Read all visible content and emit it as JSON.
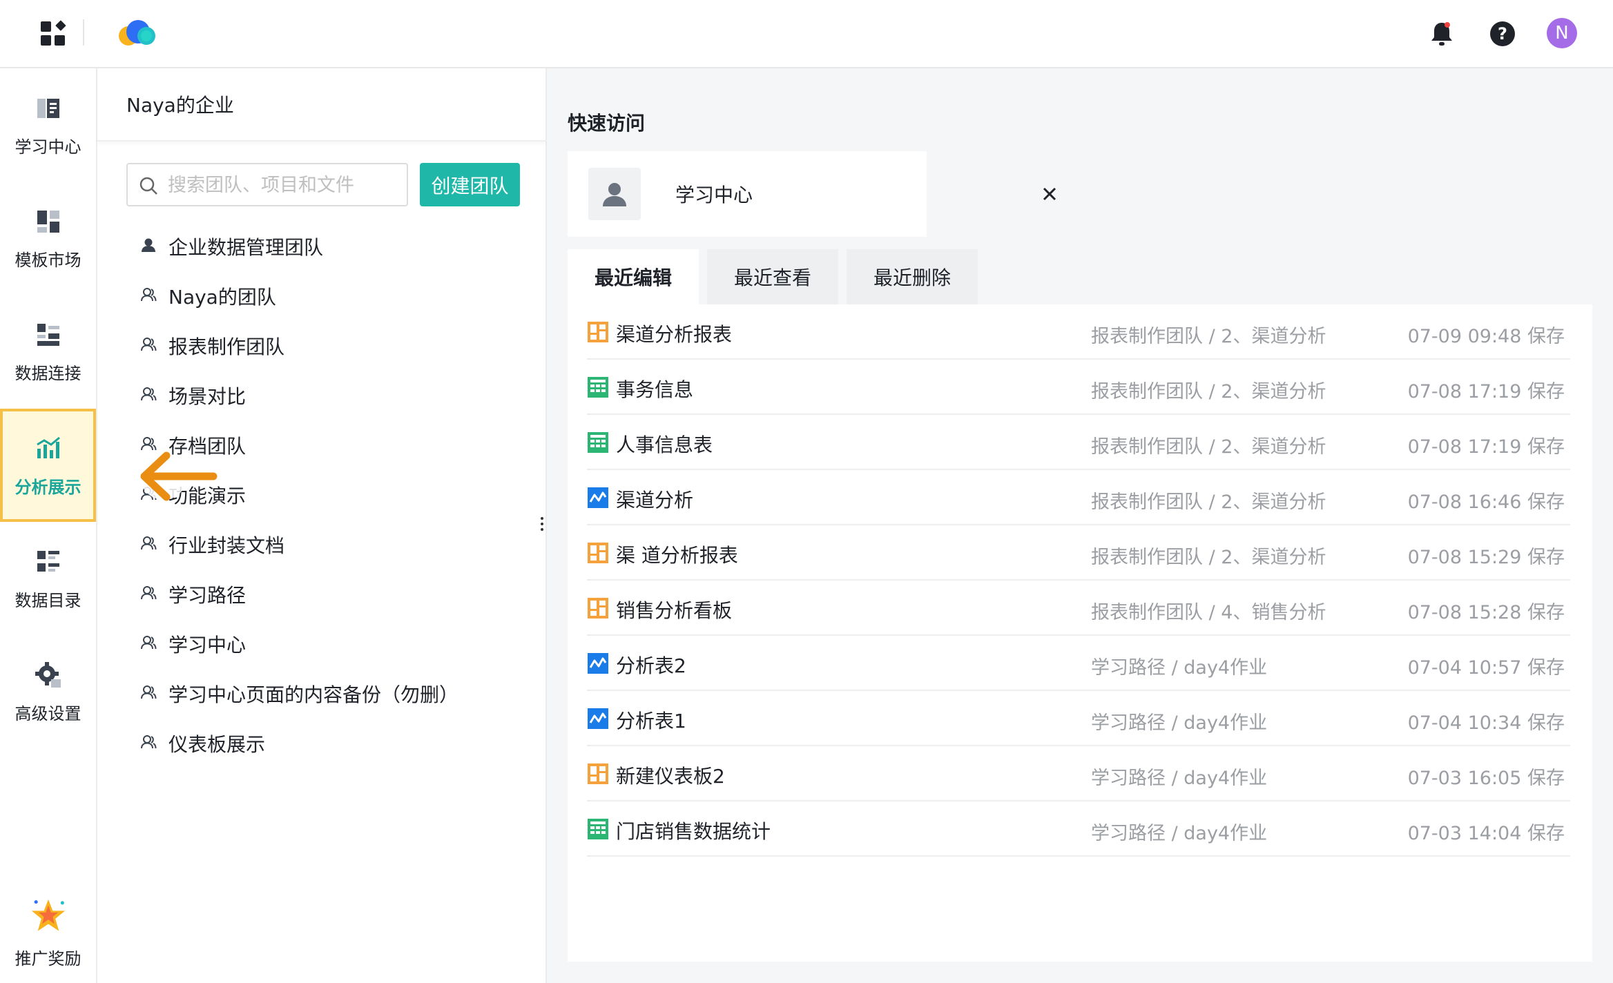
{
  "colors": {
    "brand": "#1fb7a8",
    "active_nav_bg": "#fff8db",
    "active_nav_border": "#f4c048",
    "avatar": "#a56ce8",
    "arrow": "#e98e12",
    "dashboard_icon": "#f5a23c",
    "table_icon": "#2bb673",
    "analysis_icon": "#1a7ce8"
  },
  "topbar": {
    "avatar_letter": "N",
    "icons": [
      "apps-grid-icon",
      "cloud-logo",
      "bell-icon",
      "help-icon"
    ]
  },
  "leftnav": {
    "items": [
      {
        "label": "学习中心",
        "icon": "book-icon"
      },
      {
        "label": "模板市场",
        "icon": "template-icon"
      },
      {
        "label": "数据连接",
        "icon": "data-connect-icon"
      },
      {
        "label": "分析展示",
        "icon": "chart-icon",
        "active": true
      },
      {
        "label": "数据目录",
        "icon": "catalog-icon"
      },
      {
        "label": "高级设置",
        "icon": "gear-icon"
      }
    ],
    "promo": {
      "label": "推广奖励",
      "icon": "star-icon"
    }
  },
  "teampanel": {
    "org_name": "Naya的企业",
    "search_placeholder": "搜索团队、项目和文件",
    "create_button": "创建团队",
    "teams": [
      {
        "label": "企业数据管理团队",
        "icon": "user-filled-icon"
      },
      {
        "label": "Naya的团队",
        "icon": "team-icon"
      },
      {
        "label": "报表制作团队",
        "icon": "team-icon"
      },
      {
        "label": "场景对比",
        "icon": "team-icon"
      },
      {
        "label": "存档团队",
        "icon": "team-icon"
      },
      {
        "label": "功能演示",
        "icon": "team-icon"
      },
      {
        "label": "行业封装文档",
        "icon": "team-icon"
      },
      {
        "label": "学习路径",
        "icon": "team-icon"
      },
      {
        "label": "学习中心",
        "icon": "team-icon"
      },
      {
        "label": "学习中心页面的内容备份（勿删）",
        "icon": "team-icon"
      },
      {
        "label": "仪表板展示",
        "icon": "team-icon"
      }
    ]
  },
  "main": {
    "quick_access_title": "快速访问",
    "quick_card": {
      "label": "学习中心",
      "icon": "user-avatar-icon"
    },
    "tabs": [
      {
        "label": "最近编辑",
        "active": true
      },
      {
        "label": "最近查看"
      },
      {
        "label": "最近删除"
      }
    ],
    "files": [
      {
        "name": "渠道分析报表",
        "type": "dashboard",
        "path": "报表制作团队 / 2、渠道分析",
        "time": "07-09 09:48 保存"
      },
      {
        "name": "事务信息",
        "type": "table",
        "path": "报表制作团队 / 2、渠道分析",
        "time": "07-08 17:19 保存"
      },
      {
        "name": "人事信息表",
        "type": "table",
        "path": "报表制作团队 / 2、渠道分析",
        "time": "07-08 17:19 保存"
      },
      {
        "name": "渠道分析",
        "type": "analysis",
        "path": "报表制作团队 / 2、渠道分析",
        "time": "07-08 16:46 保存"
      },
      {
        "name": "渠 道分析报表",
        "type": "dashboard",
        "path": "报表制作团队 / 2、渠道分析",
        "time": "07-08 15:29 保存"
      },
      {
        "name": "销售分析看板",
        "type": "dashboard",
        "path": "报表制作团队 / 4、销售分析",
        "time": "07-08 15:28 保存"
      },
      {
        "name": "分析表2",
        "type": "analysis",
        "path": "学习路径 / day4作业",
        "time": "07-04 10:57 保存"
      },
      {
        "name": "分析表1",
        "type": "analysis",
        "path": "学习路径 / day4作业",
        "time": "07-04 10:34 保存"
      },
      {
        "name": "新建仪表板2",
        "type": "dashboard",
        "path": "学习路径 / day4作业",
        "time": "07-03 16:05 保存"
      },
      {
        "name": "门店销售数据统计",
        "type": "table",
        "path": "学习路径 / day4作业",
        "time": "07-03 14:04 保存"
      }
    ]
  }
}
